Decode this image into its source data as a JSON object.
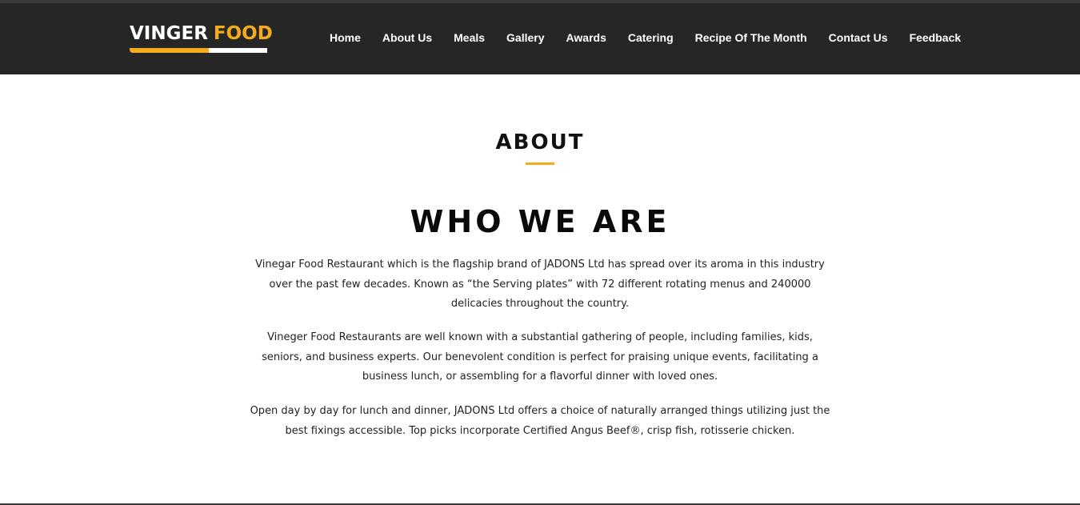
{
  "brand": {
    "word1": "VINGER",
    "word2": "FOOD",
    "accent_color": "#f5ac1c",
    "nav_background": "#262626"
  },
  "nav": {
    "items": [
      {
        "label": "Home"
      },
      {
        "label": "About Us"
      },
      {
        "label": "Meals"
      },
      {
        "label": "Gallery"
      },
      {
        "label": "Awards"
      },
      {
        "label": "Catering"
      },
      {
        "label": "Recipe Of The Month"
      },
      {
        "label": "Contact Us"
      },
      {
        "label": "Feedback"
      }
    ]
  },
  "main": {
    "section_title": "ABOUT",
    "heading": "WHO WE ARE",
    "paragraphs": [
      "Vinegar Food Restaurant which is the flagship brand of JADONS Ltd has spread over its aroma in this industry over the past few decades. Known as “the Serving plates” with 72 different rotating menus and 240000 delicacies throughout the country.",
      "Vineger Food Restaurants are well known with a substantial gathering of people, including families, kids, seniors, and business experts. Our benevolent condition is perfect for praising unique events, facilitating a business lunch, or assembling for a flavorful dinner with loved ones.",
      "Open day by day for lunch and dinner, JADONS Ltd offers a choice of naturally arranged things utilizing just the best fixings accessible. Top picks incorporate Certified Angus Beef®, crisp fish, rotisserie chicken."
    ]
  }
}
